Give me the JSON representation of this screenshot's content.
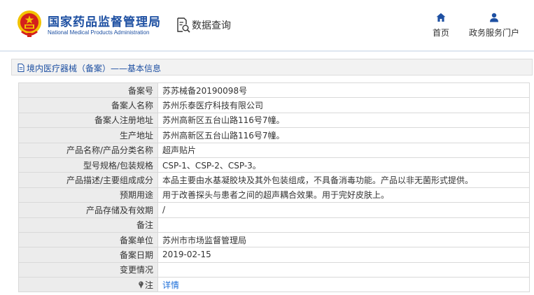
{
  "header": {
    "logo_cn": "国家药品监督管理局",
    "logo_en": "National Medical Products Administration",
    "query_label": "数据查询",
    "nav": [
      {
        "label": "首页",
        "icon": "home-icon"
      },
      {
        "label": "政务服务门户",
        "icon": "user-icon"
      }
    ]
  },
  "breadcrumb": {
    "text": "境内医疗器械（备案）——基本信息"
  },
  "table": {
    "rows": [
      {
        "label": "备案号",
        "value": "苏苏械备20190098号"
      },
      {
        "label": "备案人名称",
        "value": "苏州乐泰医疗科技有限公司"
      },
      {
        "label": "备案人注册地址",
        "value": "苏州高新区五台山路116号7幢。"
      },
      {
        "label": "生产地址",
        "value": "苏州高新区五台山路116号7幢。"
      },
      {
        "label": "产品名称/产品分类名称",
        "value": "超声贴片"
      },
      {
        "label": "型号规格/包装规格",
        "value": "CSP-1、CSP-2、CSP-3。"
      },
      {
        "label": "产品描述/主要组成成分",
        "value": "本品主要由水基凝胶块及其外包装组成，不具备消毒功能。产品以非无菌形式提供。"
      },
      {
        "label": "预期用途",
        "value": "用于改善探头与患者之间的超声耦合效果。用于完好皮肤上。"
      },
      {
        "label": "产品存储及有效期",
        "value": "/"
      },
      {
        "label": "备注",
        "value": ""
      },
      {
        "label": "备案单位",
        "value": "苏州市市场监督管理局"
      },
      {
        "label": "备案日期",
        "value": "2019-02-15"
      },
      {
        "label": "变更情况",
        "value": ""
      },
      {
        "label": "注",
        "value": "详情"
      }
    ]
  },
  "colors": {
    "brand_blue": "#1e50a2",
    "link_blue": "#1e6fd9",
    "label_bg": "#ececec",
    "emblem_red": "#d4201c",
    "emblem_gold": "#f2c200"
  }
}
